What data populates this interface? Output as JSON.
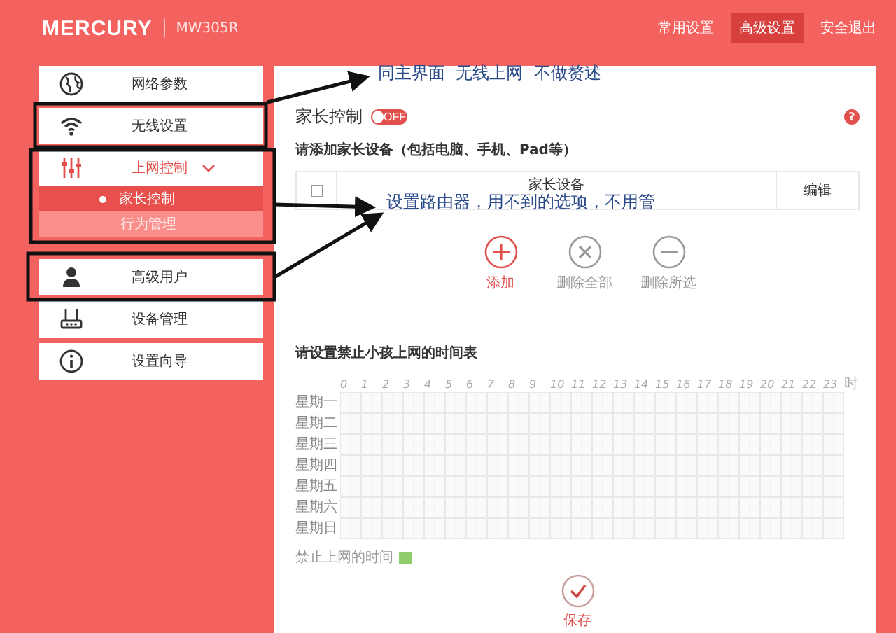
{
  "header": {
    "brand": "MERCURY",
    "model": "MW305R",
    "nav": [
      {
        "label": "常用设置",
        "selected": false
      },
      {
        "label": "高级设置",
        "selected": true
      },
      {
        "label": "安全退出",
        "selected": false
      }
    ]
  },
  "sidebar": {
    "items": [
      {
        "label": "网络参数",
        "expanded": false
      },
      {
        "label": "无线设置",
        "expanded": false
      },
      {
        "label": "上网控制",
        "expanded": true,
        "children": [
          {
            "label": "家长控制",
            "selected": true
          },
          {
            "label": "行为管理",
            "selected": false
          }
        ]
      },
      {
        "label": "高级用户",
        "expanded": false
      },
      {
        "label": "设备管理",
        "expanded": false
      },
      {
        "label": "设置向导",
        "expanded": false
      }
    ]
  },
  "parental_control": {
    "title": "家长控制",
    "toggle_label": "OFF",
    "on": false,
    "help": "?",
    "hint": "请添加家长设备（包括电脑、手机、Pad等）",
    "table": {
      "select_all": {
        "checked": false
      },
      "columns": [
        "家长设备",
        "编辑"
      ]
    },
    "actions": [
      {
        "kind": "add",
        "label": "添加"
      },
      {
        "kind": "clear",
        "label": "删除全部"
      },
      {
        "kind": "remove",
        "label": "删除所选"
      }
    ]
  },
  "schedule": {
    "title": "请设置禁止小孩上网的时间表",
    "hours": [
      "0",
      "1",
      "2",
      "3",
      "4",
      "5",
      "6",
      "7",
      "8",
      "9",
      "10",
      "11",
      "12",
      "13",
      "14",
      "15",
      "16",
      "17",
      "18",
      "19",
      "20",
      "21",
      "22",
      "23",
      "时"
    ],
    "days": [
      "星期一",
      "星期二",
      "星期三",
      "星期四",
      "星期五",
      "星期六",
      "星期日"
    ],
    "legend": "禁止上网的时间",
    "save": "保存"
  },
  "annotations": [
    {
      "text": "同主界面  无线上网  不做赘述"
    },
    {
      "text": "设置路由器，用不到的选项，不用管"
    }
  ]
}
